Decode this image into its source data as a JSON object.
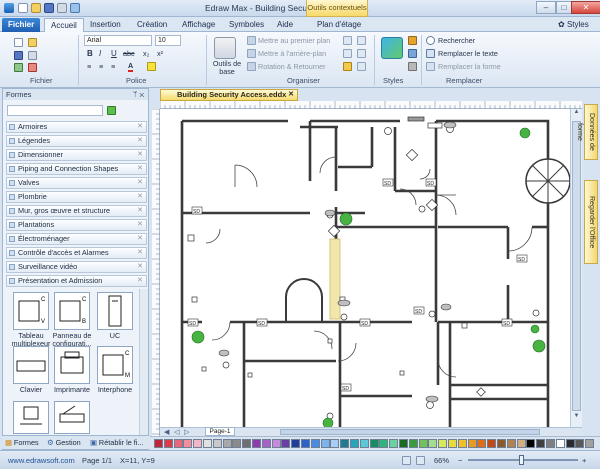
{
  "window": {
    "title": "Edraw Max - Building Security Access.eddx",
    "context_tab": "Outils contextuels",
    "minimize": "–",
    "maximize": "□",
    "close": "✕"
  },
  "tabs": [
    "Fichier",
    "Accueil",
    "Insertion",
    "Création",
    "Affichage",
    "Symboles",
    "Aide",
    "Plan d'étage"
  ],
  "styles_menu": "Styles",
  "ribbon": {
    "groups": {
      "fichier": "Fichier",
      "police": "Police",
      "organiser": "Organiser",
      "styles": "Styles",
      "remplacer": "Remplacer"
    },
    "font_name": "Arial",
    "font_size": "10",
    "format_buttons": [
      "B",
      "I",
      "U",
      "abc",
      "x₂",
      "x²"
    ],
    "align_buttons": [
      "≡",
      "≡",
      "≡",
      "A"
    ],
    "outils_de_base": "Outils de base",
    "mettre_premier_plan": "Mettre au premier plan",
    "mettre_arriere_plan": "Mettre à l'arrière-plan",
    "rotation": "Rotation & Retourner",
    "rechercher": "Rechercher",
    "remplacer_texte": "Remplacer le texte",
    "remplacer_forme": "Remplacer la forme"
  },
  "panel": {
    "title": "Formes",
    "pin": "ᛘ ✕",
    "categories": [
      "Armoires",
      "Légendes",
      "Dimensionner",
      "Piping and Connection Shapes",
      "Valves",
      "Plombrie",
      "Mur, gros œuvre et structure",
      "Plantations",
      "Électroménager",
      "Contrôle d'accès et Alarmes",
      "Surveillance vidéo",
      "Présentation et Admission"
    ],
    "shapes": [
      {
        "label": "Tableau multiplexeur",
        "glyph": "C V"
      },
      {
        "label": "Panneau de configurati...",
        "glyph": "C B"
      },
      {
        "label": "UC",
        "glyph": ""
      },
      {
        "label": "Clavier",
        "glyph": ""
      },
      {
        "label": "Imprimante",
        "glyph": ""
      },
      {
        "label": "Interphone",
        "glyph": "C M"
      }
    ],
    "bottom_tabs": [
      "Formes",
      "Gestion",
      "Rétablir le fi..."
    ]
  },
  "document": {
    "tab_name": "Building Security Access.eddx",
    "page_tab": "Page-1"
  },
  "floorplan_labels": [
    "SD",
    "SD",
    "SD",
    "SD",
    "SD",
    "SD",
    "SD",
    "SD",
    "SD",
    "SD"
  ],
  "side_tabs": [
    "Données de forme",
    "Regarder l'Office"
  ],
  "status": {
    "website": "www.edrawsoft.com",
    "page": "Page 1/1",
    "coords": "X=11, Y=9",
    "zoom": "66%"
  },
  "palette_colors": [
    "#c0263a",
    "#d93b4a",
    "#e8667a",
    "#f08ea0",
    "#f6b5c2",
    "#e1e1e1",
    "#c8c8c8",
    "#a8a8a8",
    "#8c8c8c",
    "#6f6f6f",
    "#8d3ea8",
    "#a762c5",
    "#c58ad8",
    "#6b3fa2",
    "#1e3f9a",
    "#2d62c9",
    "#4a8ae0",
    "#7db2ef",
    "#a7cdf5",
    "#1d7d8f",
    "#2aa4b8",
    "#5ac8d6",
    "#148e61",
    "#2fb57b",
    "#6ad19f",
    "#1b6b1e",
    "#3b9a3c",
    "#72c25c",
    "#a6dc8e",
    "#d8e95c",
    "#eada3d",
    "#f0c02b",
    "#e99a22",
    "#dd6f1a",
    "#c24a16",
    "#8c5a2b",
    "#b08253",
    "#d2ae83",
    "#000000",
    "#404040",
    "#808080",
    "#ffffff",
    "#2a2a2a",
    "#595959",
    "#a0a0a0"
  ]
}
